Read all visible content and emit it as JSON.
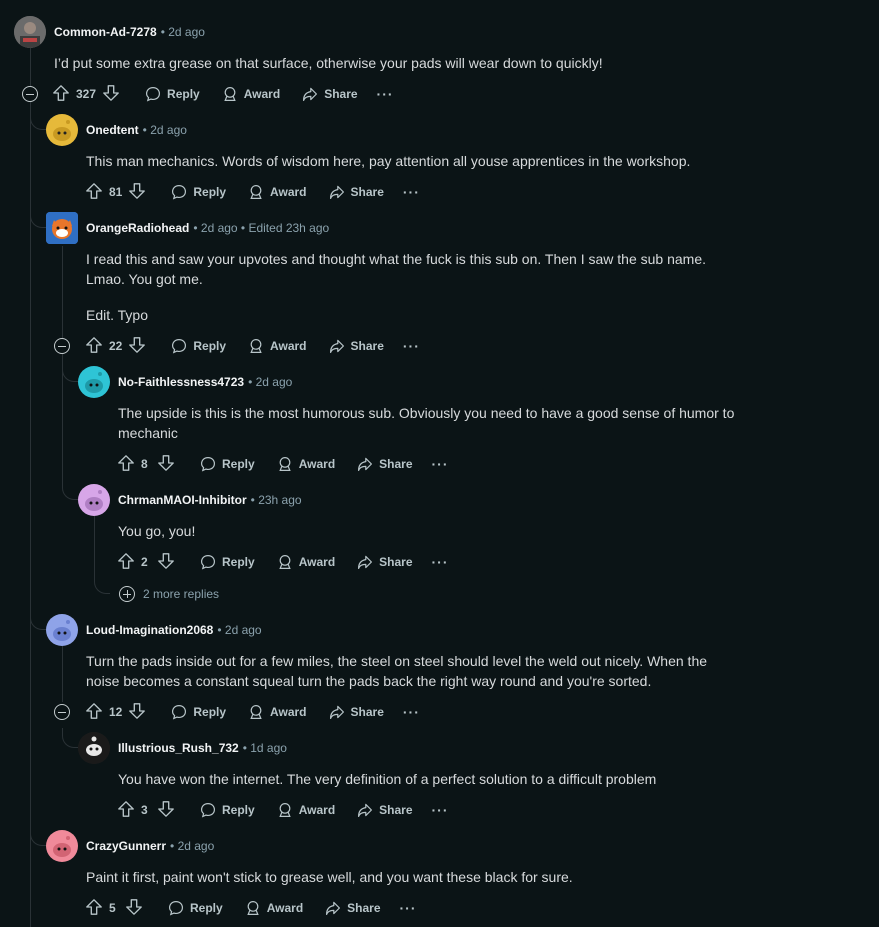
{
  "actions": {
    "reply": "Reply",
    "award": "Award",
    "share": "Share",
    "more": "···"
  },
  "comments": [
    {
      "author": "Common-Ad-7278",
      "meta": "• 2d ago",
      "avatar_color": "#5a5a5a",
      "avatar_icon": "user-photo-avatar",
      "body": [
        "I’d put some extra grease on that surface, otherwise your pads will wear down to quickly!"
      ],
      "votes": "327"
    },
    {
      "author": "Onedtent",
      "meta": "• 2d ago",
      "avatar_color": "#e6b93a",
      "avatar_icon": "snoo-avatar",
      "body": [
        "This man mechanics. Words of wisdom here, pay attention all youse apprentices in the workshop."
      ],
      "votes": "81"
    },
    {
      "author": "OrangeRadiohead",
      "meta": "• 2d ago • Edited 23h ago",
      "avatar_color": "#3a7bd5",
      "avatar_icon": "fox-avatar",
      "body": [
        "I read this and saw your upvotes and thought what the fuck is this sub on. Then I saw the sub name. Lmao. You got me.",
        "Edit. Typo"
      ],
      "votes": "22"
    },
    {
      "author": "No-Faithlessness4723",
      "meta": "• 2d ago",
      "avatar_color": "#2ec4d6",
      "avatar_icon": "snoo-avatar",
      "body": [
        "The upside is this is the most humorous sub. Obviously you need to have a good sense of humor to mechanic"
      ],
      "votes": "8"
    },
    {
      "author": "ChrmanMAOI-Inhibitor",
      "meta": "• 23h ago",
      "avatar_color": "#d7a6e8",
      "avatar_icon": "snoo-avatar",
      "body": [
        "You go, you!"
      ],
      "votes": "2"
    },
    {
      "author": "Loud-Imagination2068",
      "meta": "• 2d ago",
      "avatar_color": "#8fa3e8",
      "avatar_icon": "snoo-avatar",
      "body": [
        "Turn the pads inside out for a few miles, the steel on steel should level the weld out nicely. When the noise becomes a constant squeal turn the pads back the right way round and you're sorted."
      ],
      "votes": "12"
    },
    {
      "author": "Illustrious_Rush_732",
      "meta": "• 1d ago",
      "avatar_color": "#222222",
      "avatar_icon": "snoo-dark-avatar",
      "body": [
        "You have won the internet. The very definition of a perfect solution to a difficult problem"
      ],
      "votes": "3"
    },
    {
      "author": "CrazyGunnerr",
      "meta": "• 2d ago",
      "avatar_color": "#f08a9a",
      "avatar_icon": "snoo-avatar",
      "body": [
        "Paint it first, paint won't stick to grease well, and you want these black for sure."
      ],
      "votes": "5"
    }
  ],
  "more_replies": "2 more replies"
}
